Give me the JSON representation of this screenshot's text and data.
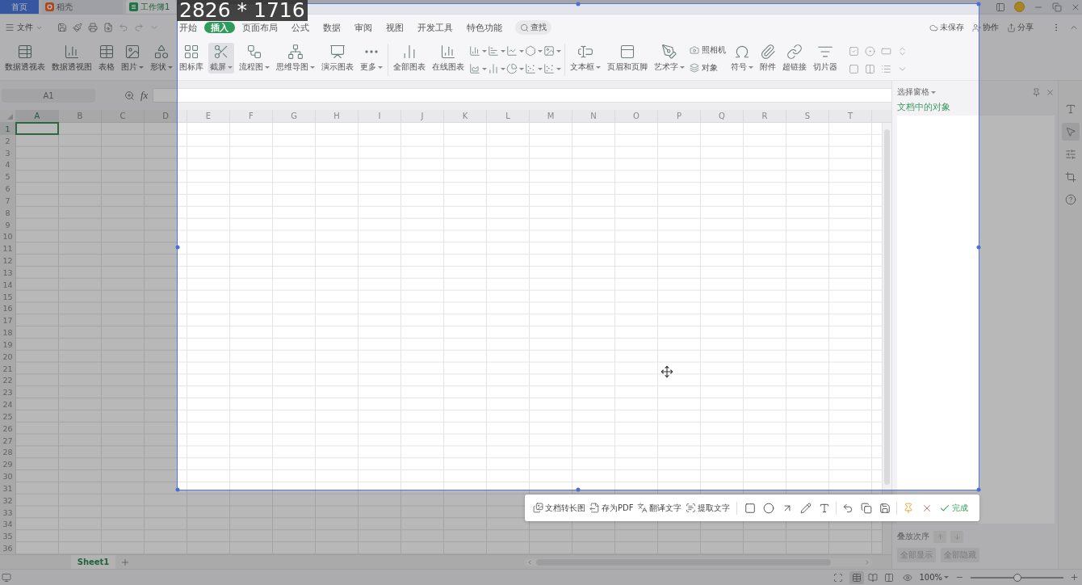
{
  "title_bar": {
    "tabs": [
      {
        "kind": "home",
        "label": "首页",
        "selected": false
      },
      {
        "kind": "web",
        "label": "稻壳",
        "selected": false
      },
      {
        "kind": "workbook",
        "label": "工作簿1",
        "selected": true
      }
    ]
  },
  "menu_bar": {
    "file_menu": "文件",
    "tabs": [
      {
        "label": "开始",
        "selected": false
      },
      {
        "label": "插入",
        "selected": true
      },
      {
        "label": "页面布局",
        "selected": false
      },
      {
        "label": "公式",
        "selected": false
      },
      {
        "label": "数据",
        "selected": false
      },
      {
        "label": "审阅",
        "selected": false
      },
      {
        "label": "视图",
        "selected": false
      },
      {
        "label": "开发工具",
        "selected": false
      },
      {
        "label": "特色功能",
        "selected": false
      }
    ],
    "search": "查找",
    "actions": [
      "未保存",
      "协作",
      "分享"
    ]
  },
  "ribbon": {
    "groups": [
      {
        "items": [
          {
            "kind": "large",
            "label": "数据透视表",
            "dropdown": false,
            "active": false
          },
          {
            "kind": "large",
            "label": "数据透视图",
            "dropdown": false,
            "active": false
          },
          {
            "kind": "large",
            "label": "表格",
            "dropdown": false,
            "active": false
          },
          {
            "kind": "large",
            "label": "图片",
            "dropdown": true,
            "active": false
          },
          {
            "kind": "large",
            "label": "形状",
            "dropdown": true,
            "active": false
          },
          {
            "kind": "large",
            "label": "图标库",
            "dropdown": false,
            "active": false
          },
          {
            "kind": "large",
            "label": "截屏",
            "dropdown": true,
            "active": true
          },
          {
            "kind": "large",
            "label": "流程图",
            "dropdown": true,
            "active": false
          },
          {
            "kind": "large",
            "label": "思维导图",
            "dropdown": true,
            "active": false
          },
          {
            "kind": "large",
            "label": "演示图表",
            "dropdown": false,
            "active": false
          },
          {
            "kind": "large",
            "label": "更多",
            "dropdown": true,
            "active": false
          }
        ]
      },
      {
        "items": [
          {
            "kind": "large",
            "label": "全部图表",
            "dropdown": false,
            "active": false
          },
          {
            "kind": "large",
            "label": "在线图表",
            "dropdown": false,
            "active": false
          },
          {
            "kind": "chart_grid"
          }
        ]
      },
      {
        "items": [
          {
            "kind": "large",
            "label": "文本框",
            "dropdown": true,
            "active": false
          },
          {
            "kind": "large",
            "label": "页眉和页脚",
            "dropdown": false,
            "active": false
          },
          {
            "kind": "large",
            "label": "艺术字",
            "dropdown": true,
            "active": false
          },
          {
            "kind": "stack",
            "labels": [
              "照相机",
              "对象"
            ]
          },
          {
            "kind": "large",
            "label": "符号",
            "dropdown": true,
            "active": false
          },
          {
            "kind": "large",
            "label": "附件",
            "dropdown": false,
            "active": false
          },
          {
            "kind": "large",
            "label": "超链接",
            "dropdown": false,
            "active": false
          },
          {
            "kind": "large",
            "label": "切片器",
            "dropdown": false,
            "active": false
          },
          {
            "kind": "form_controls"
          }
        ]
      }
    ]
  },
  "formula_bar": {
    "cell_name": "A1",
    "function_label": "fx"
  },
  "sheet": {
    "columns": [
      {
        "label": "A",
        "selected": true
      },
      {
        "label": "B",
        "selected": false
      },
      {
        "label": "C",
        "selected": false
      },
      {
        "label": "D",
        "selected": false
      },
      {
        "label": "E",
        "selected": false
      },
      {
        "label": "F",
        "selected": false
      },
      {
        "label": "G",
        "selected": false
      },
      {
        "label": "H",
        "selected": false
      },
      {
        "label": "I",
        "selected": false
      },
      {
        "label": "J",
        "selected": false
      },
      {
        "label": "K",
        "selected": false
      },
      {
        "label": "L",
        "selected": false
      },
      {
        "label": "M",
        "selected": false
      },
      {
        "label": "N",
        "selected": false
      },
      {
        "label": "O",
        "selected": false
      },
      {
        "label": "P",
        "selected": false
      },
      {
        "label": "Q",
        "selected": false
      },
      {
        "label": "R",
        "selected": false
      },
      {
        "label": "S",
        "selected": false
      },
      {
        "label": "T",
        "selected": false
      }
    ],
    "rows": [
      {
        "label": "1",
        "selected": true
      },
      {
        "label": "2",
        "selected": false
      },
      {
        "label": "3",
        "selected": false
      },
      {
        "label": "4",
        "selected": false
      },
      {
        "label": "5",
        "selected": false
      },
      {
        "label": "6",
        "selected": false
      },
      {
        "label": "7",
        "selected": false
      },
      {
        "label": "8",
        "selected": false
      },
      {
        "label": "9",
        "selected": false
      },
      {
        "label": "10",
        "selected": false
      },
      {
        "label": "11",
        "selected": false
      },
      {
        "label": "12",
        "selected": false
      },
      {
        "label": "13",
        "selected": false
      },
      {
        "label": "14",
        "selected": false
      },
      {
        "label": "15",
        "selected": false
      },
      {
        "label": "16",
        "selected": false
      },
      {
        "label": "17",
        "selected": false
      },
      {
        "label": "18",
        "selected": false
      },
      {
        "label": "19",
        "selected": false
      },
      {
        "label": "20",
        "selected": false
      },
      {
        "label": "21",
        "selected": false
      },
      {
        "label": "22",
        "selected": false
      },
      {
        "label": "23",
        "selected": false
      },
      {
        "label": "24",
        "selected": false
      },
      {
        "label": "25",
        "selected": false
      },
      {
        "label": "26",
        "selected": false
      },
      {
        "label": "27",
        "selected": false
      },
      {
        "label": "28",
        "selected": false
      },
      {
        "label": "29",
        "selected": false
      },
      {
        "label": "30",
        "selected": false
      },
      {
        "label": "31",
        "selected": false
      },
      {
        "label": "32",
        "selected": false
      },
      {
        "label": "33",
        "selected": false
      },
      {
        "label": "34",
        "selected": false
      },
      {
        "label": "35",
        "selected": false
      },
      {
        "label": "36",
        "selected": false
      }
    ]
  },
  "sheet_tabs": [
    {
      "label": "Sheet1",
      "selected": true
    }
  ],
  "selection_pane": {
    "title": "选择窗格",
    "subtitle": "文档中的对象",
    "order_label": "叠放次序",
    "buttons": [
      {
        "label": "全部显示",
        "disabled": true
      },
      {
        "label": "全部隐藏",
        "disabled": true
      }
    ]
  },
  "side_tools": [
    {
      "selected": false
    },
    {
      "selected": true
    },
    {
      "selected": false
    },
    {
      "selected": false
    },
    {
      "selected": false
    }
  ],
  "status_bar": {
    "view_buttons": [
      {
        "selected": true
      },
      {
        "selected": false
      },
      {
        "selected": false
      }
    ],
    "zoom": "100%",
    "zoom_slider": {
      "level": 0.5
    }
  },
  "capture": {
    "size_label": "2826 * 1716",
    "actions": [
      "文档转长图",
      "存为PDF",
      "翻译文字",
      "提取文字"
    ],
    "done": "完成"
  }
}
